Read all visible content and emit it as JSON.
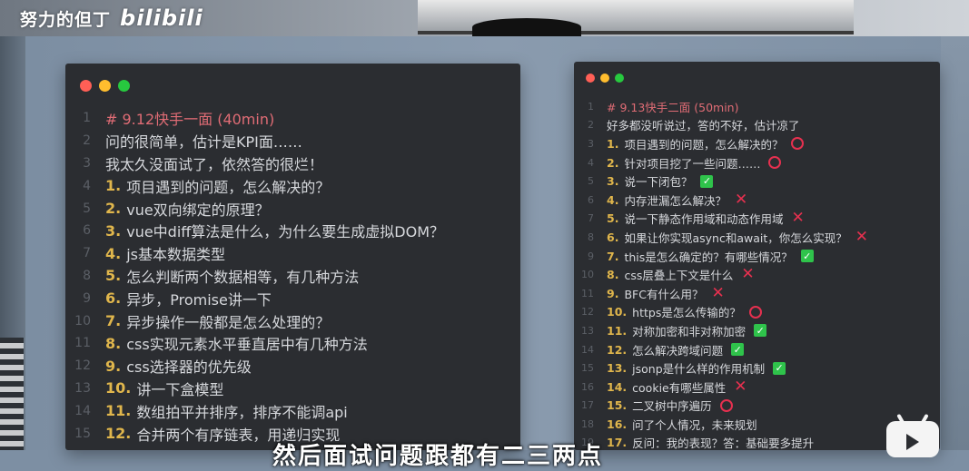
{
  "watermark": {
    "text": "努力的但丁",
    "logo": "bilibili"
  },
  "colors": {
    "dot_red": "#ff5f56",
    "dot_yellow": "#ffbd2e",
    "dot_green": "#27c93f"
  },
  "left_panel": {
    "lines": [
      {
        "ln": "1",
        "num": "",
        "text": "# 9.12快手一面 (40min)",
        "heading": true,
        "mark": ""
      },
      {
        "ln": "2",
        "num": "",
        "text": "问的很简单，估计是KPI面……",
        "mark": ""
      },
      {
        "ln": "3",
        "num": "",
        "text": "我太久没面试了，依然答的很烂！",
        "mark": ""
      },
      {
        "ln": "4",
        "num": "1.",
        "text": "项目遇到的问题，怎么解决的？",
        "mark": ""
      },
      {
        "ln": "5",
        "num": "2.",
        "text": "vue双向绑定的原理？",
        "mark": ""
      },
      {
        "ln": "6",
        "num": "3.",
        "text": "vue中diff算法是什么，为什么要生成虚拟DOM？",
        "mark": ""
      },
      {
        "ln": "7",
        "num": "4.",
        "text": "js基本数据类型",
        "mark": ""
      },
      {
        "ln": "8",
        "num": "5.",
        "text": "怎么判断两个数据相等，有几种方法",
        "mark": ""
      },
      {
        "ln": "9",
        "num": "6.",
        "text": "异步，Promise讲一下",
        "mark": ""
      },
      {
        "ln": "10",
        "num": "7.",
        "text": "异步操作一般都是怎么处理的？",
        "mark": ""
      },
      {
        "ln": "11",
        "num": "8.",
        "text": "css实现元素水平垂直居中有几种方法",
        "mark": ""
      },
      {
        "ln": "12",
        "num": "9.",
        "text": "css选择器的优先级",
        "mark": ""
      },
      {
        "ln": "13",
        "num": "10.",
        "text": "讲一下盒模型",
        "mark": ""
      },
      {
        "ln": "14",
        "num": "11.",
        "text": "数组拍平并排序，排序不能调api",
        "mark": ""
      },
      {
        "ln": "15",
        "num": "12.",
        "text": "合并两个有序链表，用递归实现",
        "mark": ""
      }
    ]
  },
  "right_panel": {
    "lines": [
      {
        "ln": "1",
        "num": "",
        "text": "# 9.13快手二面 (50min)",
        "heading": true,
        "mark": ""
      },
      {
        "ln": "2",
        "num": "",
        "text": "好多都没听说过，答的不好，估计凉了",
        "mark": ""
      },
      {
        "ln": "3",
        "num": "1.",
        "text": "项目遇到的问题，怎么解决的？",
        "mark": "circle"
      },
      {
        "ln": "4",
        "num": "2.",
        "text": "针对项目挖了一些问题……",
        "mark": "circle"
      },
      {
        "ln": "5",
        "num": "3.",
        "text": "说一下闭包？",
        "mark": "check"
      },
      {
        "ln": "6",
        "num": "4.",
        "text": "内存泄漏怎么解决？",
        "mark": "cross"
      },
      {
        "ln": "7",
        "num": "5.",
        "text": "说一下静态作用域和动态作用域",
        "mark": "cross"
      },
      {
        "ln": "8",
        "num": "6.",
        "text": "如果让你实现async和await，你怎么实现？",
        "mark": "cross"
      },
      {
        "ln": "9",
        "num": "7.",
        "text": "this是怎么确定的？有哪些情况？",
        "mark": "check"
      },
      {
        "ln": "10",
        "num": "8.",
        "text": "css层叠上下文是什么",
        "mark": "cross"
      },
      {
        "ln": "11",
        "num": "9.",
        "text": "BFC有什么用？",
        "mark": "cross"
      },
      {
        "ln": "12",
        "num": "10.",
        "text": "https是怎么传输的？",
        "mark": "circle"
      },
      {
        "ln": "13",
        "num": "11.",
        "text": "对称加密和非对称加密",
        "mark": "check"
      },
      {
        "ln": "14",
        "num": "12.",
        "text": "怎么解决跨域问题",
        "mark": "check"
      },
      {
        "ln": "15",
        "num": "13.",
        "text": "jsonp是什么样的作用机制",
        "mark": "check"
      },
      {
        "ln": "16",
        "num": "14.",
        "text": "cookie有哪些属性",
        "mark": "cross"
      },
      {
        "ln": "17",
        "num": "15.",
        "text": "二叉树中序遍历",
        "mark": "circle"
      },
      {
        "ln": "18",
        "num": "16.",
        "text": "问了个人情况，未来规划",
        "mark": ""
      },
      {
        "ln": "19",
        "num": "17.",
        "text": "反问：我的表现？答：基础要多提升",
        "mark": ""
      }
    ]
  },
  "subtitle": {
    "text": "然后面试问题跟都有二三两点"
  }
}
